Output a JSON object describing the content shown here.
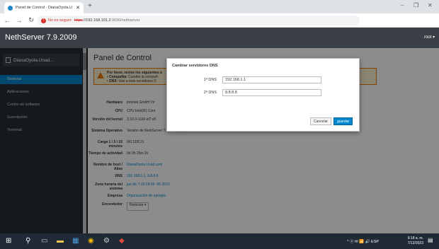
{
  "browser": {
    "tab_title": "Panel de Control - DianaOyola.U",
    "tab_close": "✕",
    "new_tab": "+",
    "not_secure": "No es seguro",
    "url_scheme": "https",
    "url_host": "://192.168.101.2",
    "url_path": ":9090/nethserver",
    "window_controls": {
      "min": "–",
      "max": "❐",
      "close": "✕"
    }
  },
  "app": {
    "brand": "NethServer 7.9.2009",
    "user": "root ▾"
  },
  "sidebar": {
    "host": "DianaOyola.Unad...",
    "items": [
      {
        "label": "Sistema",
        "active": true
      },
      {
        "label": "Aplicaciones",
        "active": false
      },
      {
        "label": "Centro de software",
        "active": false
      },
      {
        "label": "Suscripción",
        "active": false
      },
      {
        "label": "Terminal",
        "active": false
      }
    ]
  },
  "main": {
    "title": "Panel de Control",
    "alert": {
      "heading": "Por favor, revise los siguientes a",
      "line1_bold": "Compañía",
      "line1_text": ": Cambie la compañ",
      "line2_bold": "DNS",
      "line2_text": ": Use a más servidores D"
    },
    "info": [
      {
        "label": "Hardware",
        "value": "innotek GmbH Vir"
      },
      {
        "label": "CPU",
        "value": "CPU Intel(R) Core"
      },
      {
        "label": "Versión del kernel",
        "value": "3.10.0-1160.el7.x8"
      },
      {
        "label": "Sistema Operativo",
        "value": "Versión de NethServer 7.9.2009 (final)"
      },
      {
        "label": "Carga 1 / 5 / 15 minutos",
        "value": "0/0,11/0,21"
      },
      {
        "label": "Tiempo de actividad",
        "value": "0d 0h 25m 2s"
      },
      {
        "label": "Nombre de host / Alias",
        "value": "DianaOyola.Unad.com",
        "link": true
      },
      {
        "label": "DNS",
        "value": "192.168.1.1, 8.8.8.8",
        "link": true
      },
      {
        "label": "Zona horaria del sistema",
        "value": "jue dic 7 09:18:05 -05 2023",
        "link": true
      },
      {
        "label": "Empresa",
        "value": "Organización de ejemplo",
        "link": true
      },
      {
        "label": "Encendedor",
        "value": "Reiniciar ▾"
      }
    ]
  },
  "modal": {
    "title": "Cambiar servidores DNS",
    "dns1_label": "1º DNS",
    "dns1_value": "192.168.1.1",
    "dns2_label": "2º DNS",
    "dns2_value": "8.8.8.8",
    "cancel": "Cancelar",
    "save": "guardar"
  },
  "taskbar": {
    "tray": "^ ⓔ ✉ 📶 🔊 ESP",
    "time": "9:18 a. m.",
    "date": "7/12/2023"
  },
  "colors": {
    "accent": "#0088ce",
    "header": "#393f44",
    "sidebar": "#292e34",
    "alert": "#ec7a08"
  }
}
